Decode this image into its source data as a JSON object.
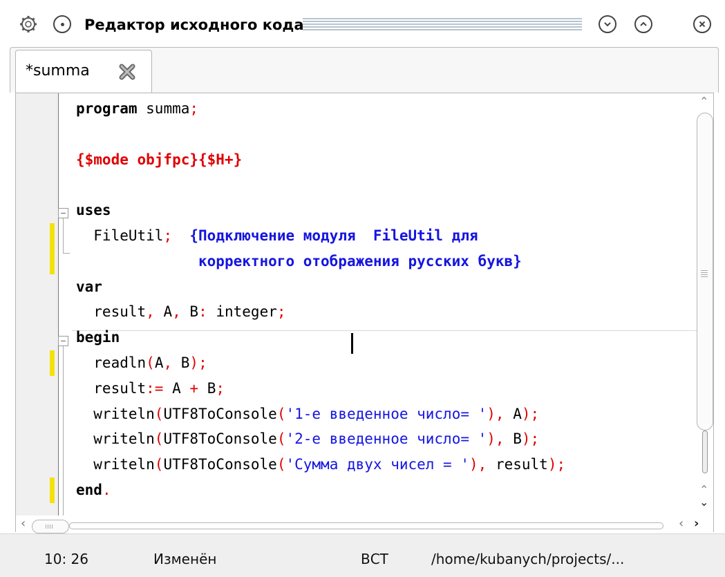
{
  "window": {
    "title": "Редактор исходного кода",
    "controls": [
      "menu",
      "minimize",
      "maximize",
      "close"
    ]
  },
  "tab": {
    "label": "*summa"
  },
  "code": {
    "lines": [
      [
        {
          "t": "program",
          "c": "kw"
        },
        {
          "t": " summa"
        },
        {
          "t": ";",
          "c": "sym"
        }
      ],
      [],
      [
        {
          "t": "{$mode objfpc}{$H+}",
          "c": "dir"
        }
      ],
      [],
      [
        {
          "t": "uses",
          "c": "kw"
        }
      ],
      [
        {
          "t": "  FileUtil"
        },
        {
          "t": ";",
          "c": "sym"
        },
        {
          "t": "  "
        },
        {
          "t": "{Подключение модуля  FileUtil для",
          "c": "cm"
        }
      ],
      [
        {
          "t": "              "
        },
        {
          "t": "корректного отображения русских букв}",
          "c": "cm"
        }
      ],
      [
        {
          "t": "var",
          "c": "kw"
        }
      ],
      [
        {
          "t": "  result"
        },
        {
          "t": ",",
          "c": "sym"
        },
        {
          "t": " A"
        },
        {
          "t": ",",
          "c": "sym"
        },
        {
          "t": " B"
        },
        {
          "t": ":",
          "c": "sym"
        },
        {
          "t": " integer"
        },
        {
          "t": ";",
          "c": "sym"
        }
      ],
      [
        {
          "t": "begin",
          "c": "kw"
        }
      ],
      [
        {
          "t": "  readln"
        },
        {
          "t": "(",
          "c": "sym"
        },
        {
          "t": "A"
        },
        {
          "t": ",",
          "c": "sym"
        },
        {
          "t": " B"
        },
        {
          "t": ");",
          "c": "sym"
        }
      ],
      [
        {
          "t": "  result"
        },
        {
          "t": ":=",
          "c": "sym"
        },
        {
          "t": " A "
        },
        {
          "t": "+",
          "c": "sym"
        },
        {
          "t": " B"
        },
        {
          "t": ";",
          "c": "sym"
        }
      ],
      [
        {
          "t": "  writeln"
        },
        {
          "t": "(",
          "c": "sym"
        },
        {
          "t": "UTF8ToConsole"
        },
        {
          "t": "(",
          "c": "sym"
        },
        {
          "t": "'1-е введенное число= '",
          "c": "str"
        },
        {
          "t": "),",
          "c": "sym"
        },
        {
          "t": " A"
        },
        {
          "t": ");",
          "c": "sym"
        }
      ],
      [
        {
          "t": "  writeln"
        },
        {
          "t": "(",
          "c": "sym"
        },
        {
          "t": "UTF8ToConsole"
        },
        {
          "t": "(",
          "c": "sym"
        },
        {
          "t": "'2-е введенное число= '",
          "c": "str"
        },
        {
          "t": "),",
          "c": "sym"
        },
        {
          "t": " B"
        },
        {
          "t": ");",
          "c": "sym"
        }
      ],
      [
        {
          "t": "  writeln"
        },
        {
          "t": "(",
          "c": "sym"
        },
        {
          "t": "UTF8ToConsole"
        },
        {
          "t": "(",
          "c": "sym"
        },
        {
          "t": "'Сумма двух чисел = '",
          "c": "str"
        },
        {
          "t": "),",
          "c": "sym"
        },
        {
          "t": " result"
        },
        {
          "t": ");",
          "c": "sym"
        }
      ],
      [
        {
          "t": "end",
          "c": "kw"
        },
        {
          "t": ".",
          "c": "sym"
        }
      ]
    ],
    "modified_lines": [
      6,
      7,
      11,
      16
    ]
  },
  "status": {
    "position": "10: 26",
    "state": "Изменён",
    "mode": "ВСТ",
    "path": "/home/kubanych/projects/..."
  },
  "colors": {
    "keyword": "#000000",
    "directive": "#e00000",
    "comment": "#1515e0",
    "symbol": "#e00000",
    "string": "#1515e0",
    "modified_marker": "#f5e10a"
  }
}
